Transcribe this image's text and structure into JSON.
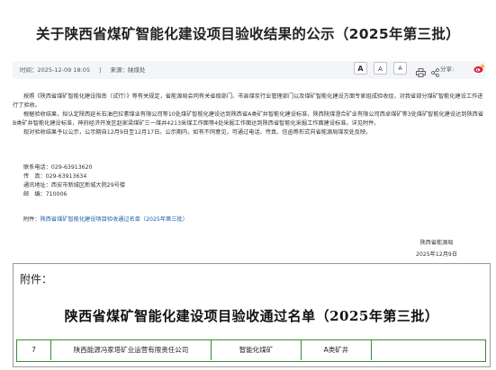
{
  "article": {
    "title": "关于陕西省煤矿智能化建设项目验收结果的公示（2025年第三批）",
    "meta": {
      "time_label": "时间：",
      "time": "2025-12-09 18:05",
      "separator": "|",
      "source_label": "来源：",
      "source": "陕煤处"
    },
    "toolbar": {
      "font_large": "A",
      "font_medium": "A",
      "font_small": "A",
      "share_label": "分享:"
    },
    "paragraphs": [
      "按照《陕西省煤矿智能化建设指南（试行）》等有关规定，省能源局会同有关省级部门、市县煤炭行业管理部门以及煤矿智能化建设方面专家组成验收组，对我省部分煤矿智能化建设工作进行了验收。",
      "根据验收结果，拟认定陕西延长石油巴拉素煤业有限公司等10处煤矿智能化建设达到陕西省A类矿井智能化建设标准，陕西陕煤澄合矿业有限公司西卓煤矿等3处煤矿智能化建设达到陕西省B类矿井智能化建设标准，神府经济开发区赵家梁煤矿三一煤井4213采煤工作面等4处采掘工作面达到陕西省智能化采掘工作面建设标准。详见附件。",
      "现对验收结果予以公示，公示期自12月9日至12月17日。公示期内，如有不同意见，可通过电话、传真、信函等形式向省能源局煤炭处反映。"
    ],
    "contacts": [
      "联系电话：029-63913620",
      "传　真：029-63913634",
      "通讯地址：西安市新城区新城大院29号楼",
      "邮　编：710006"
    ],
    "attachment": {
      "label": "附件：",
      "link_text": "陕西省煤矿智能化建设项目验收通过名单（2025年第三批）"
    },
    "signature": {
      "org": "陕西省能源局",
      "date": "2025年12月9日"
    }
  },
  "attachment_preview": {
    "label": "附件：",
    "title": "陕西省煤矿智能化建设项目验收通过名单（2025年第三批）",
    "row": {
      "no": "7",
      "company": "陕西能源冯家塔矿业运营有限责任公司",
      "category": "智能化煤矿",
      "grade": "A类矿井",
      "extra": ""
    }
  },
  "colors": {
    "link": "#1a5ba8",
    "table_border": "#3a8a3a",
    "weibo": "#e6162d"
  }
}
